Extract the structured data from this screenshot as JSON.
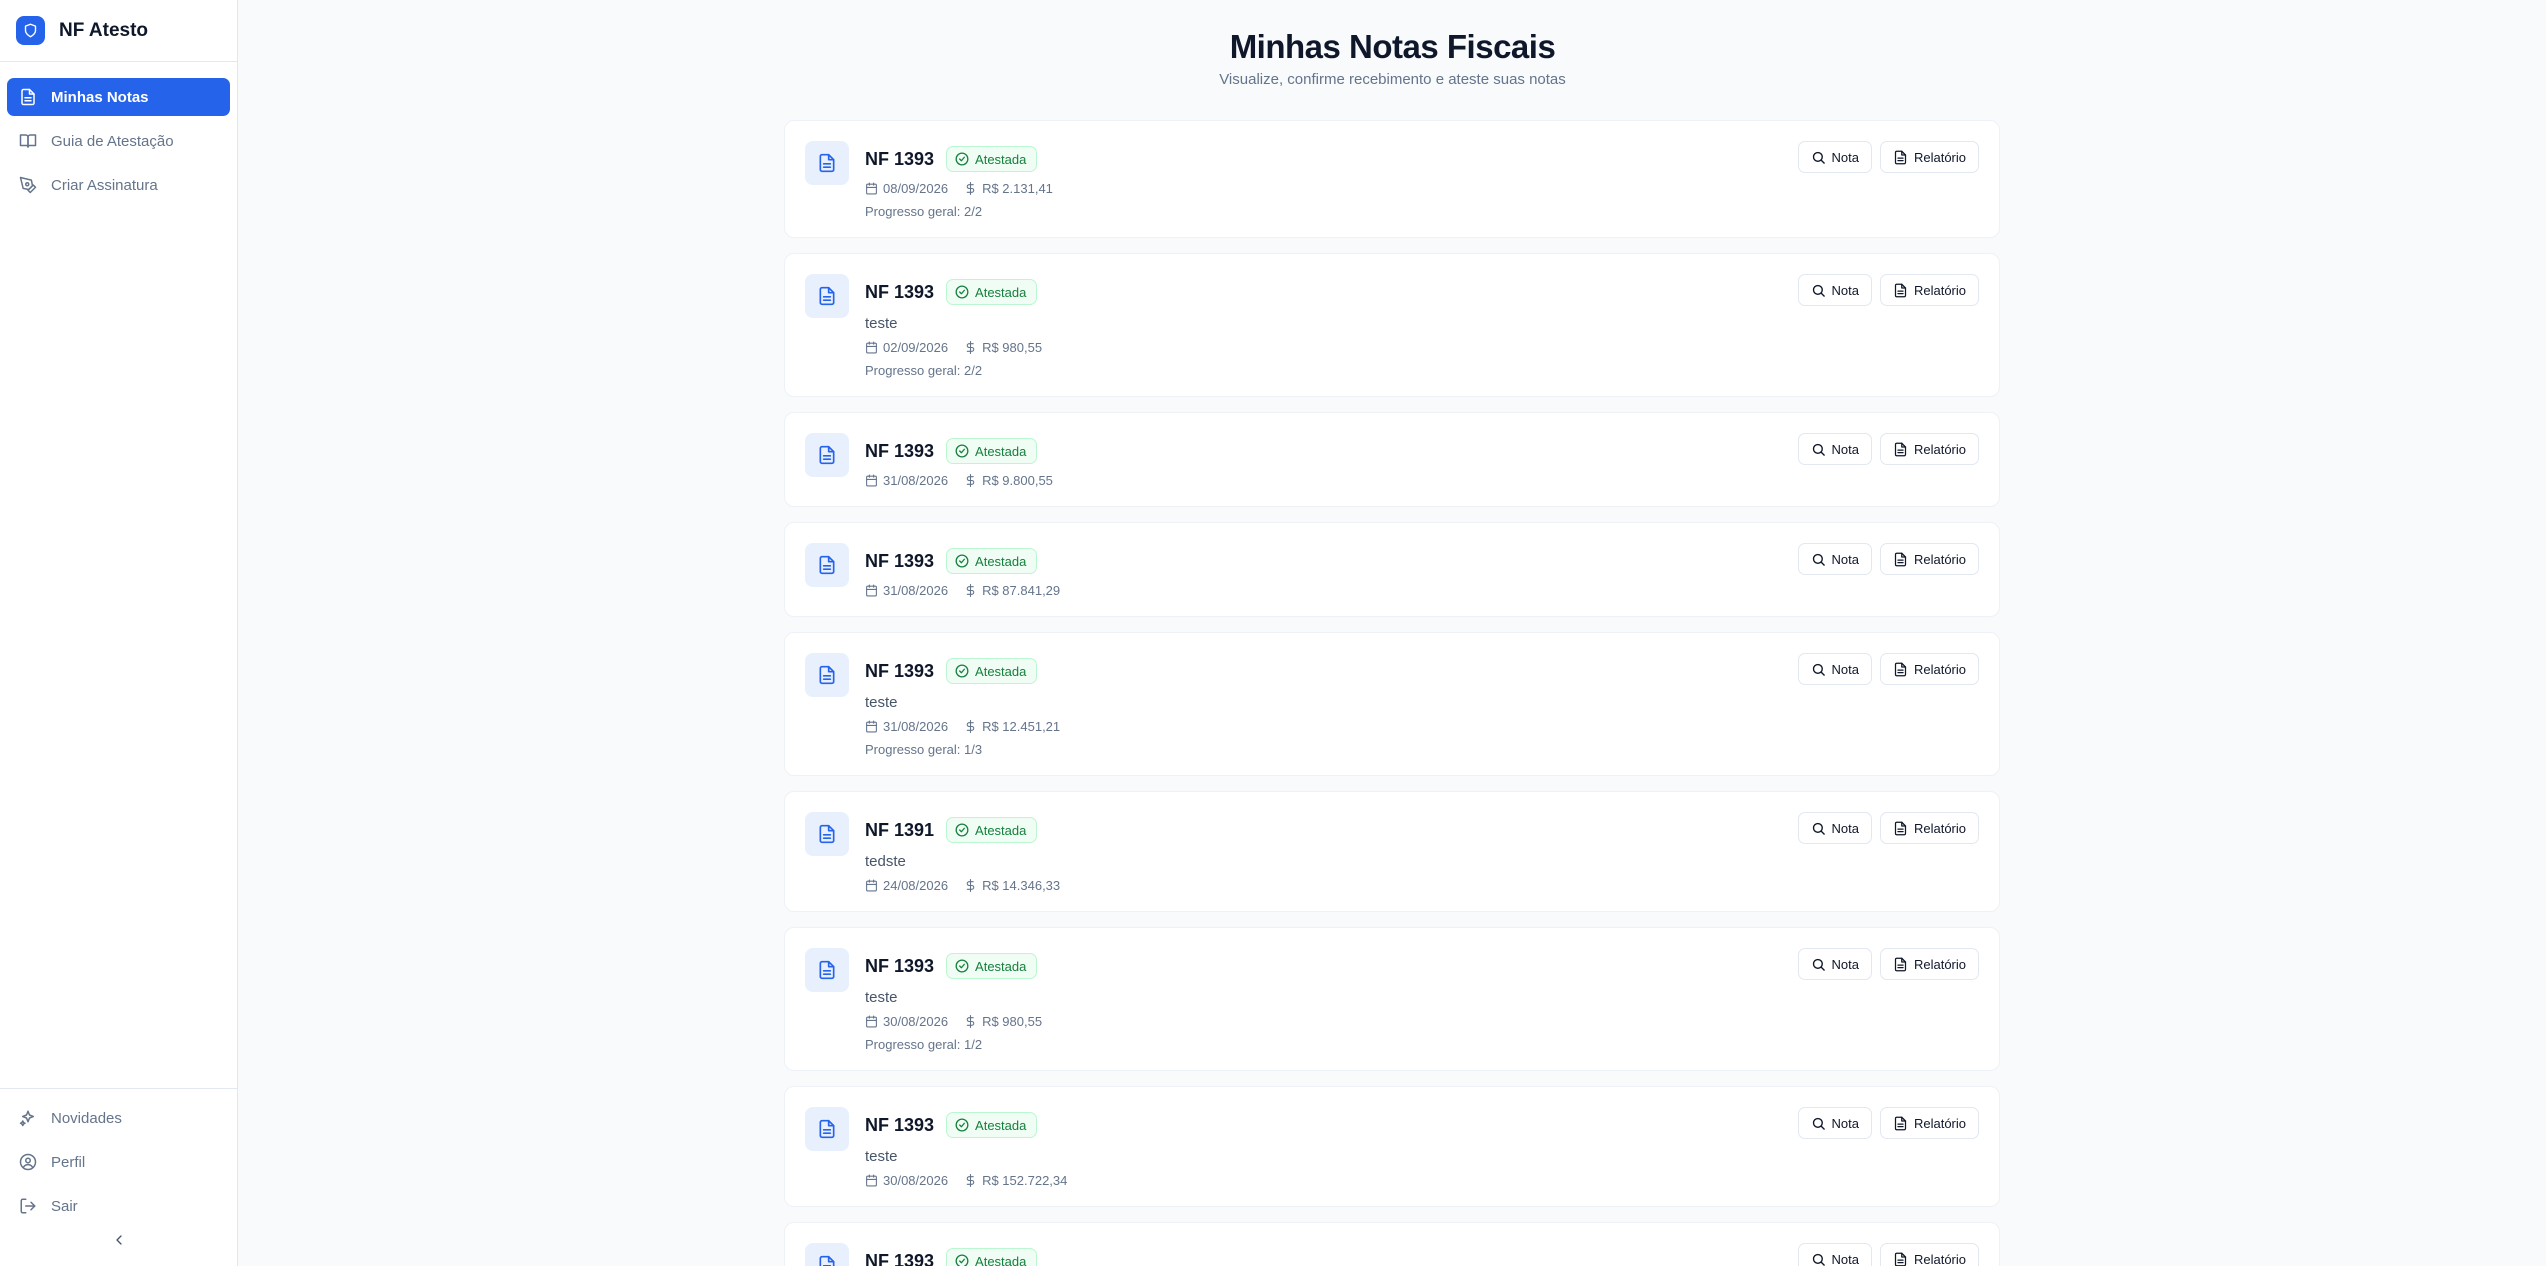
{
  "brand": {
    "name": "NF Atesto"
  },
  "sidebar": {
    "items": [
      {
        "label": "Minhas Notas",
        "icon": "file-text-icon",
        "active": true
      },
      {
        "label": "Guia de Atestação",
        "icon": "book-icon",
        "active": false
      },
      {
        "label": "Criar Assinatura",
        "icon": "pen-tool-icon",
        "active": false
      }
    ],
    "bottom": [
      {
        "label": "Novidades",
        "icon": "sparkles-icon"
      },
      {
        "label": "Perfil",
        "icon": "user-circle-icon"
      },
      {
        "label": "Sair",
        "icon": "logout-icon"
      }
    ]
  },
  "header": {
    "title": "Minhas Notas Fiscais",
    "subtitle": "Visualize, confirme recebimento e ateste suas notas"
  },
  "labels": {
    "nota": "Nota",
    "relatorio": "Relatório"
  },
  "colors": {
    "accent": "#2563eb",
    "status_green": "#15803d"
  },
  "notes": [
    {
      "title": "NF 1393",
      "status": "Atestada",
      "desc": "",
      "date": "08/09/2026",
      "value": "R$ 2.131,41",
      "progress": "Progresso geral: 2/2"
    },
    {
      "title": "NF 1393",
      "status": "Atestada",
      "desc": "teste",
      "date": "02/09/2026",
      "value": "R$ 980,55",
      "progress": "Progresso geral: 2/2"
    },
    {
      "title": "NF 1393",
      "status": "Atestada",
      "desc": "",
      "date": "31/08/2026",
      "value": "R$ 9.800,55",
      "progress": ""
    },
    {
      "title": "NF 1393",
      "status": "Atestada",
      "desc": "",
      "date": "31/08/2026",
      "value": "R$ 87.841,29",
      "progress": ""
    },
    {
      "title": "NF 1393",
      "status": "Atestada",
      "desc": "teste",
      "date": "31/08/2026",
      "value": "R$ 12.451,21",
      "progress": "Progresso geral: 1/3"
    },
    {
      "title": "NF 1391",
      "status": "Atestada",
      "desc": "tedste",
      "date": "24/08/2026",
      "value": "R$ 14.346,33",
      "progress": ""
    },
    {
      "title": "NF 1393",
      "status": "Atestada",
      "desc": "teste",
      "date": "30/08/2026",
      "value": "R$ 980,55",
      "progress": "Progresso geral: 1/2"
    },
    {
      "title": "NF 1393",
      "status": "Atestada",
      "desc": "teste",
      "date": "30/08/2026",
      "value": "R$ 152.722,34",
      "progress": ""
    },
    {
      "title": "NF 1393",
      "status": "Atestada",
      "desc": "",
      "date": "",
      "value": "",
      "progress": ""
    }
  ]
}
